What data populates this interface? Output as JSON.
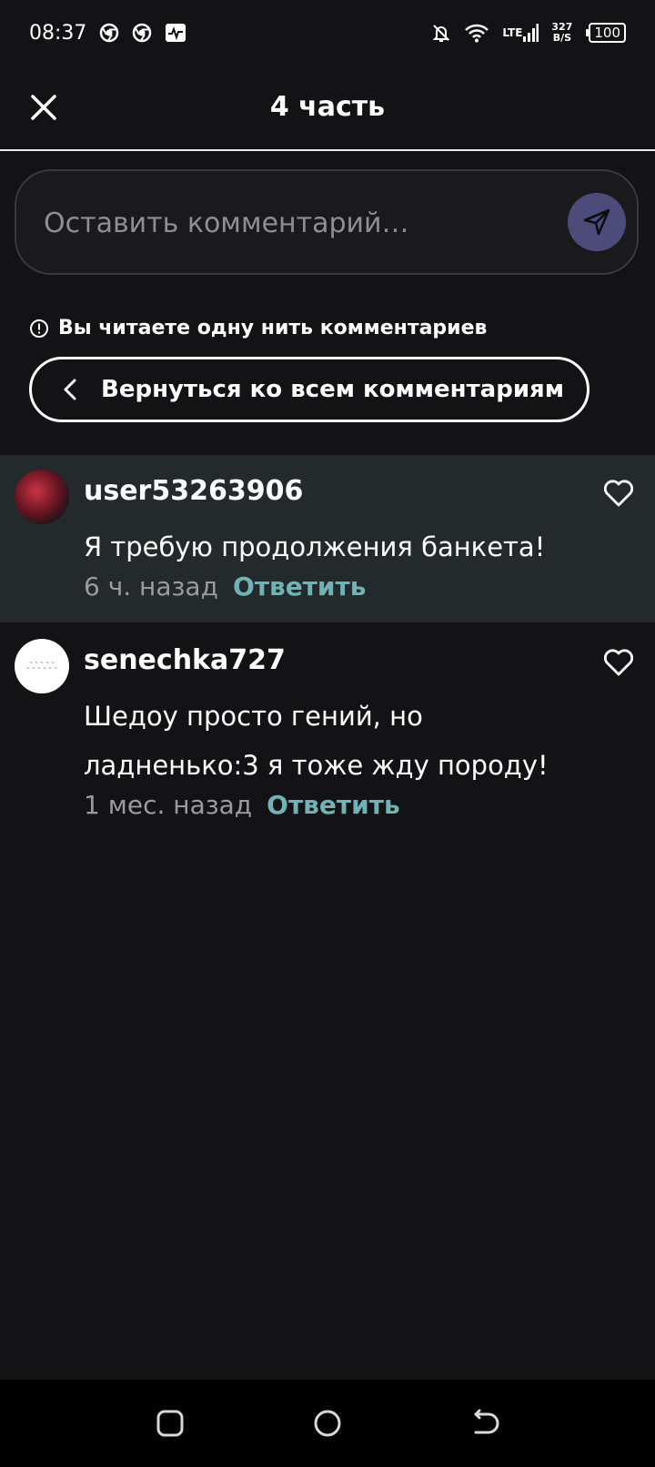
{
  "status_bar": {
    "time": "08:37",
    "network": "LTE",
    "speed_value": "327",
    "speed_unit": "B/S",
    "battery": "100",
    "icons": [
      "chrome-icon",
      "chrome-icon",
      "activity-icon",
      "bell-off-icon",
      "wifi-icon",
      "signal-icon",
      "battery-icon"
    ]
  },
  "header": {
    "title": "4 часть",
    "close_icon": "close-icon"
  },
  "comment_input": {
    "placeholder": "Оставить комментарий…",
    "send_icon": "send-icon"
  },
  "thread": {
    "notice": "Вы читаете одну нить комментариев",
    "back_label": "Вернуться ко всем комментариям"
  },
  "comments": [
    {
      "username": "user53263906",
      "text": "Я требую продолжения банкета!",
      "time": "6 ч. назад",
      "reply": "Ответить",
      "highlighted": true
    },
    {
      "username": "senechka727",
      "text": "Шедоу просто гений, но ладненько:3 я тоже жду породу!",
      "time": "1 мес. назад",
      "reply": "Ответить",
      "highlighted": false
    }
  ],
  "colors": {
    "background": "#131315",
    "highlight": "#242a2c",
    "accent_reply": "#6fb3b6",
    "send_button": "#4c4b7a"
  }
}
